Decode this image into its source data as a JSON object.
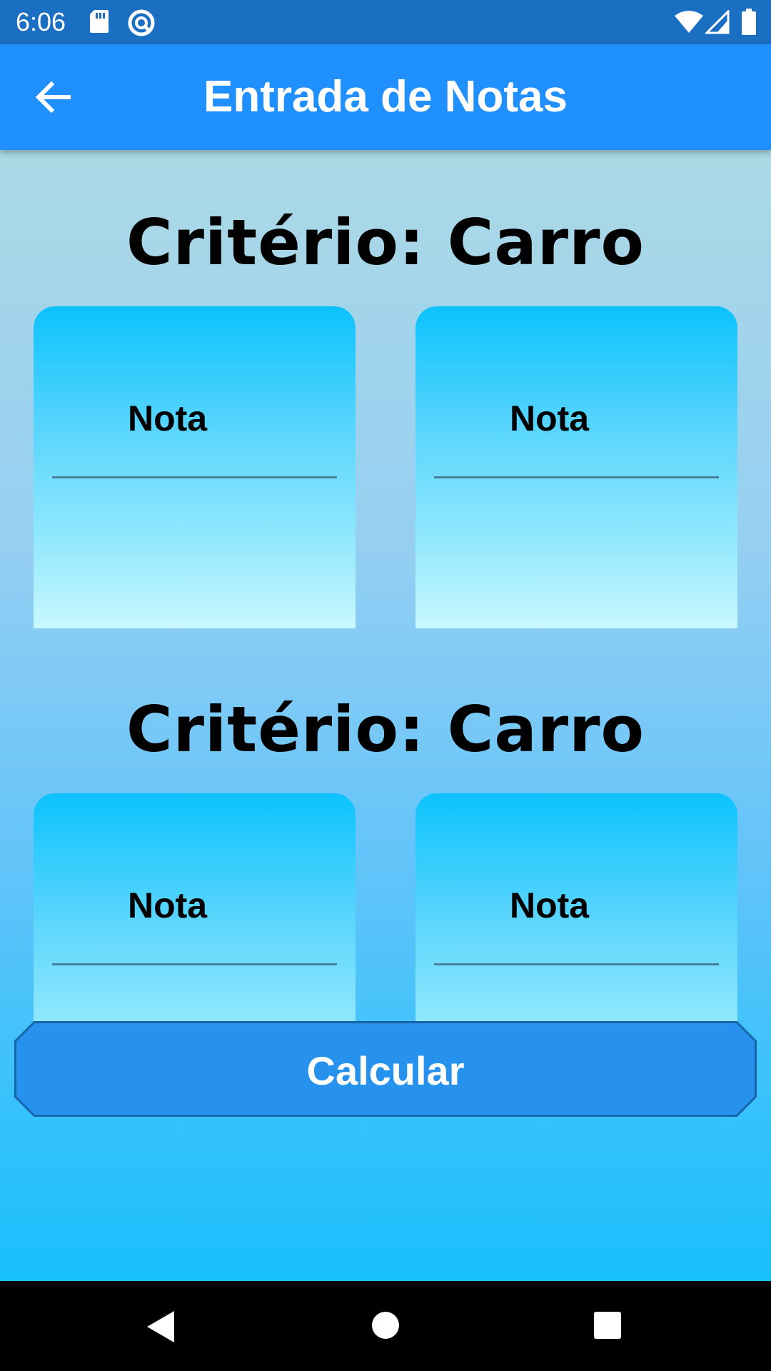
{
  "status_bar": {
    "time": "6:06",
    "icons": [
      "sd-card-icon",
      "sync-icon",
      "wifi-icon",
      "signal-icon",
      "battery-icon"
    ]
  },
  "app_bar": {
    "title": "Entrada de Notas",
    "back_icon": "arrow-left-icon"
  },
  "criteria": [
    {
      "title": "Critério: Carro",
      "notes": [
        {
          "label": "Nota",
          "value": ""
        },
        {
          "label": "Nota",
          "value": ""
        }
      ]
    },
    {
      "title": "Critério: Carro",
      "notes": [
        {
          "label": "Nota",
          "value": ""
        },
        {
          "label": "Nota",
          "value": ""
        }
      ]
    }
  ],
  "calculate_button": {
    "label": "Calcular"
  },
  "nav_bar": {
    "icons": [
      "back-triangle-icon",
      "home-circle-icon",
      "recents-square-icon"
    ]
  },
  "colors": {
    "status_bar": "#1a6fc2",
    "app_bar": "#2090ff",
    "button": "#2692ee",
    "card_top": "#0cc2fd",
    "card_bottom": "#c8f8fe"
  }
}
